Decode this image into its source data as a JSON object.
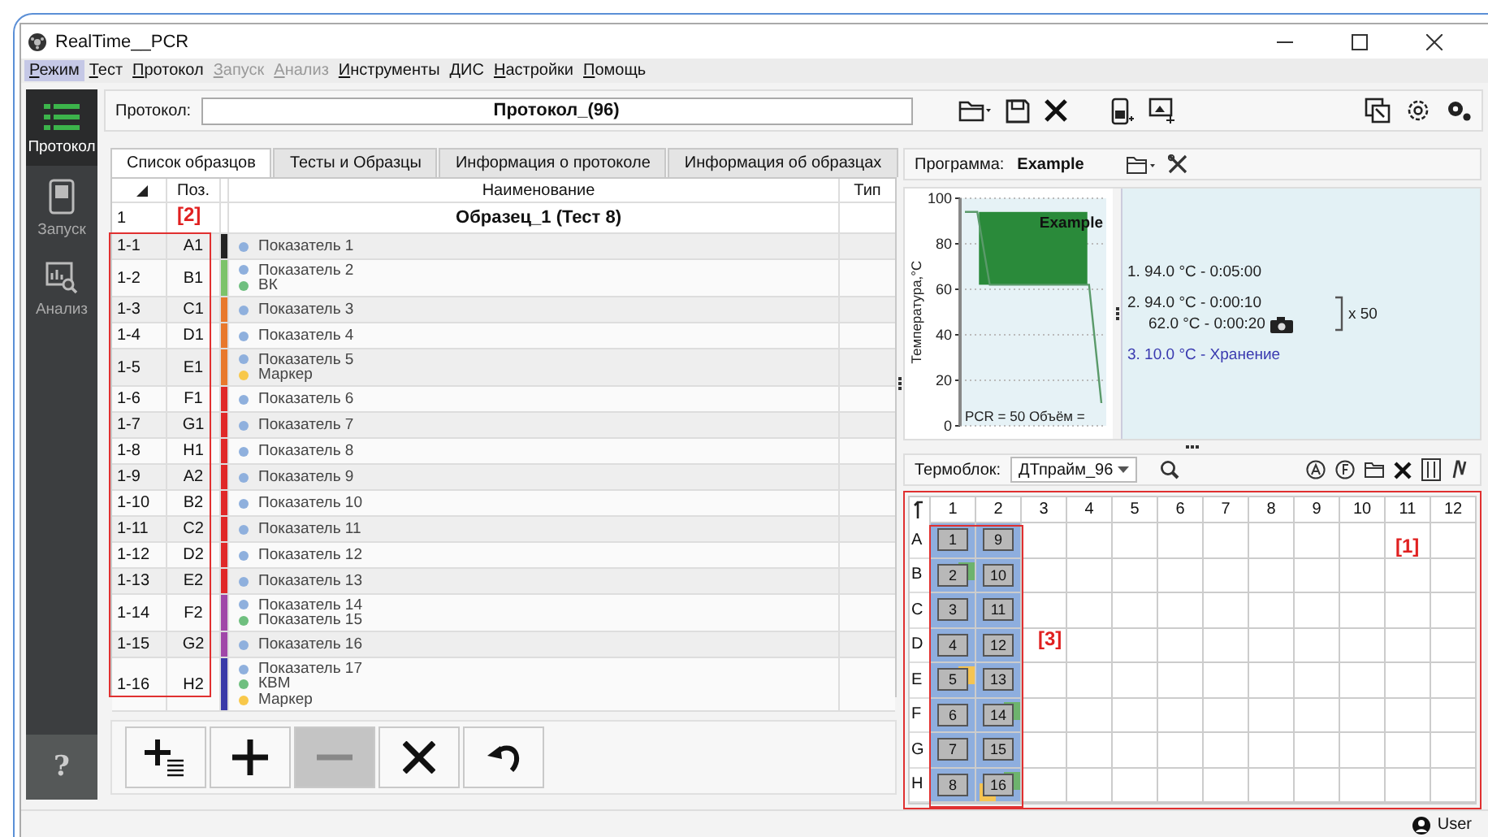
{
  "window": {
    "title": "RealTime__PCR"
  },
  "menu": [
    {
      "label": "Режим",
      "selected": true,
      "disabled": false
    },
    {
      "label": "Тест",
      "selected": false,
      "disabled": false
    },
    {
      "label": "Протокол",
      "selected": false,
      "disabled": false
    },
    {
      "label": "Запуск",
      "selected": false,
      "disabled": true
    },
    {
      "label": "Анализ",
      "selected": false,
      "disabled": true
    },
    {
      "label": "Инструменты",
      "selected": false,
      "disabled": false
    },
    {
      "label": "ДИС",
      "selected": false,
      "disabled": false
    },
    {
      "label": "Настройки",
      "selected": false,
      "disabled": false
    },
    {
      "label": "Помощь",
      "selected": false,
      "disabled": false
    }
  ],
  "sidebar": {
    "items": [
      {
        "label": "Протокол",
        "selected": true
      },
      {
        "label": "Запуск",
        "selected": false
      },
      {
        "label": "Анализ",
        "selected": false
      }
    ],
    "help": "?"
  },
  "protocol": {
    "label": "Протокол:",
    "value": "Протокол_(96)"
  },
  "tabs": [
    {
      "label": "Список образцов",
      "selected": true
    },
    {
      "label": "Тесты и Образцы",
      "selected": false
    },
    {
      "label": "Информация о протоколе",
      "selected": false
    },
    {
      "label": "Информация об образцах",
      "selected": false
    }
  ],
  "table": {
    "columns": [
      "Поз.",
      "Наименование",
      "Тип"
    ],
    "group": {
      "number": "1",
      "name": "Образец_1 (Тест 8)"
    },
    "annotation": "[2]",
    "rows": [
      {
        "number": "1-1",
        "position": "A1",
        "color": "#222222",
        "indicators": [
          {
            "name": "Показатель 1",
            "color": "#8fb0dd"
          }
        ]
      },
      {
        "number": "1-2",
        "position": "B1",
        "color": "#7cc36a",
        "indicators": [
          {
            "name": "Показатель 2",
            "color": "#8fb0dd"
          },
          {
            "name": "ВК",
            "color": "#6fbf7f"
          }
        ]
      },
      {
        "number": "1-3",
        "position": "C1",
        "color": "#e8782c",
        "indicators": [
          {
            "name": "Показатель 3",
            "color": "#8fb0dd"
          }
        ]
      },
      {
        "number": "1-4",
        "position": "D1",
        "color": "#e8782c",
        "indicators": [
          {
            "name": "Показатель 4",
            "color": "#8fb0dd"
          }
        ]
      },
      {
        "number": "1-5",
        "position": "E1",
        "color": "#e8782c",
        "indicators": [
          {
            "name": "Показатель 5",
            "color": "#8fb0dd"
          },
          {
            "name": "Маркер",
            "color": "#f8c84a"
          }
        ]
      },
      {
        "number": "1-6",
        "position": "F1",
        "color": "#e02828",
        "indicators": [
          {
            "name": "Показатель 6",
            "color": "#8fb0dd"
          }
        ]
      },
      {
        "number": "1-7",
        "position": "G1",
        "color": "#e02828",
        "indicators": [
          {
            "name": "Показатель 7",
            "color": "#8fb0dd"
          }
        ]
      },
      {
        "number": "1-8",
        "position": "H1",
        "color": "#e02828",
        "indicators": [
          {
            "name": "Показатель 8",
            "color": "#8fb0dd"
          }
        ]
      },
      {
        "number": "1-9",
        "position": "A2",
        "color": "#e02828",
        "indicators": [
          {
            "name": "Показатель 9",
            "color": "#8fb0dd"
          }
        ]
      },
      {
        "number": "1-10",
        "position": "B2",
        "color": "#e02828",
        "indicators": [
          {
            "name": "Показатель 10",
            "color": "#8fb0dd"
          }
        ]
      },
      {
        "number": "1-11",
        "position": "C2",
        "color": "#e02828",
        "indicators": [
          {
            "name": "Показатель 11",
            "color": "#8fb0dd"
          }
        ]
      },
      {
        "number": "1-12",
        "position": "D2",
        "color": "#e02828",
        "indicators": [
          {
            "name": "Показатель 12",
            "color": "#8fb0dd"
          }
        ]
      },
      {
        "number": "1-13",
        "position": "E2",
        "color": "#e02828",
        "indicators": [
          {
            "name": "Показатель 13",
            "color": "#8fb0dd"
          }
        ]
      },
      {
        "number": "1-14",
        "position": "F2",
        "color": "#a048a8",
        "indicators": [
          {
            "name": "Показатель 14",
            "color": "#8fb0dd"
          },
          {
            "name": "Показатель 15",
            "color": "#6fbf7f"
          }
        ]
      },
      {
        "number": "1-15",
        "position": "G2",
        "color": "#a048a8",
        "indicators": [
          {
            "name": "Показатель 16",
            "color": "#8fb0dd"
          }
        ]
      },
      {
        "number": "1-16",
        "position": "H2",
        "color": "#3a3aa8",
        "indicators": [
          {
            "name": "Показатель 17",
            "color": "#8fb0dd"
          },
          {
            "name": "КВМ",
            "color": "#6fbf7f"
          },
          {
            "name": "Маркер",
            "color": "#f8c84a"
          }
        ]
      }
    ]
  },
  "buttons": [
    {
      "kind": "add-list",
      "disabled": false
    },
    {
      "kind": "add",
      "disabled": false
    },
    {
      "kind": "remove",
      "disabled": true
    },
    {
      "kind": "delete",
      "disabled": false
    },
    {
      "kind": "undo",
      "disabled": false
    }
  ],
  "program": {
    "label": "Программа:",
    "name": "Example",
    "chart_data": {
      "type": "line",
      "title": "Example",
      "ylabel": "Температура,°C",
      "categories": [
        null,
        null,
        null,
        null,
        null,
        null,
        null,
        null,
        null,
        null,
        null,
        null
      ],
      "ylim": [
        0,
        100
      ],
      "yticks": [
        0,
        20,
        40,
        60,
        80,
        100
      ],
      "grid": true,
      "bands": [
        {
          "axis": "y",
          "from": 62,
          "to": 94,
          "color": "#2a8a3a"
        }
      ],
      "series": [
        {
          "color": "#5a9a6a",
          "values": [
            94,
            94,
            62,
            62,
            62,
            62,
            62,
            62,
            62,
            62,
            62,
            10
          ]
        }
      ]
    },
    "chart_note": "PCR = 50  Объём =",
    "steps": [
      {
        "kind": "hold",
        "lines": [
          "1. 94.0 °C - 0:05:00"
        ],
        "camera": false
      },
      {
        "kind": "cycle",
        "lines": [
          "2. 94.0 °C - 0:00:10",
          "62.0 °C - 0:00:20"
        ],
        "camera": true,
        "repeat": "x 50"
      },
      {
        "kind": "storage",
        "lines": [
          "3. 10.0 °C - Хранение"
        ],
        "camera": false
      }
    ]
  },
  "thermoblock": {
    "label": "Термоблок:",
    "value": "ДТпрайм_96"
  },
  "plate": {
    "columns": [
      "1",
      "2",
      "3",
      "4",
      "5",
      "6",
      "7",
      "8",
      "9",
      "10",
      "11",
      "12"
    ],
    "rows": [
      "A",
      "B",
      "C",
      "D",
      "E",
      "F",
      "G",
      "H"
    ],
    "annotations": [
      "[1]",
      "[3]"
    ],
    "wells": [
      {
        "label": "1"
      },
      {
        "label": "2",
        "marks": [
          {
            "color": "#6db36d"
          }
        ]
      },
      {
        "label": "3"
      },
      {
        "label": "4"
      },
      {
        "label": "5",
        "marks": [
          {
            "color": "#f5c452"
          }
        ]
      },
      {
        "label": "6"
      },
      {
        "label": "7"
      },
      {
        "label": "8"
      },
      {
        "label": "9"
      },
      {
        "label": "10"
      },
      {
        "label": "11"
      },
      {
        "label": "12"
      },
      {
        "label": "13"
      },
      {
        "label": "14",
        "marks": [
          {
            "color": "#6db36d"
          }
        ]
      },
      {
        "label": "15"
      },
      {
        "label": "16",
        "marks": [
          {
            "color": "#6db36d"
          },
          {
            "color": "#f5c452"
          }
        ]
      }
    ]
  },
  "status_bar": {
    "user": "User"
  }
}
